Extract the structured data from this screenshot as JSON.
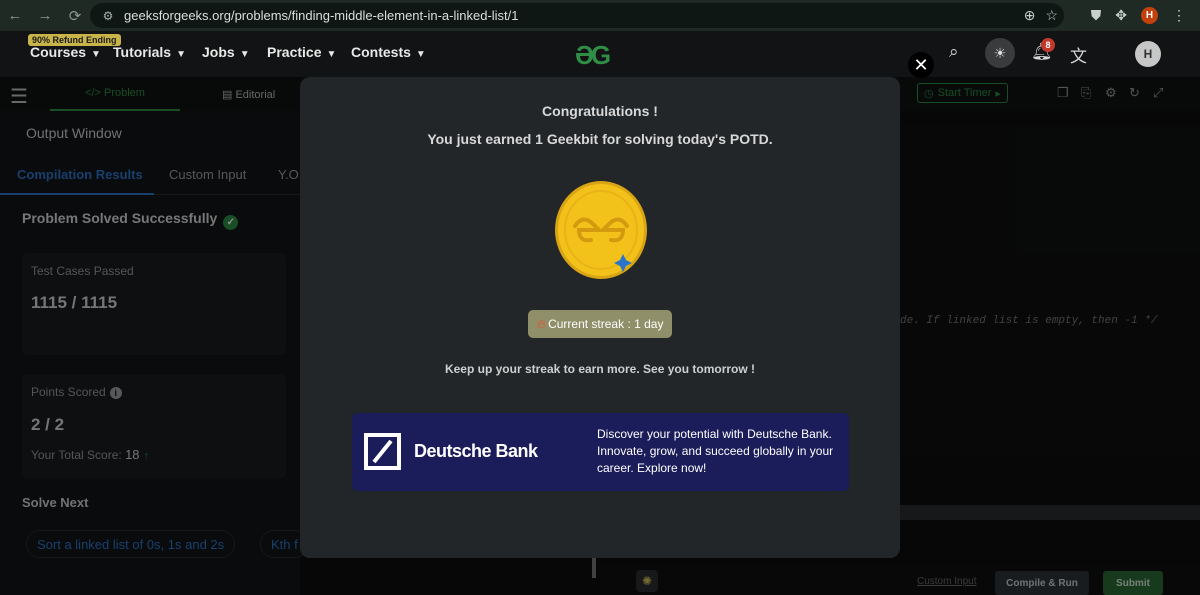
{
  "browser": {
    "url": "geeksforgeeks.org/problems/finding-middle-element-in-a-linked-list/1",
    "back_icon": "←",
    "forward_icon": "→",
    "reload_icon": "⟳",
    "profile_initial": "H"
  },
  "topnav": {
    "refund_badge": "90% Refund Ending",
    "items": [
      {
        "label": "Courses"
      },
      {
        "label": "Tutorials"
      },
      {
        "label": "Jobs"
      },
      {
        "label": "Practice"
      },
      {
        "label": "Contests"
      }
    ],
    "logo_text": "ƏG",
    "notification_count": "8",
    "avatar_initial": "H"
  },
  "subtoolbar": {
    "problem_tab": "</> Problem",
    "editorial_tab": "Editorial",
    "start_timer": "Start Timer"
  },
  "output": {
    "title": "Output Window",
    "tabs": [
      "Compilation Results",
      "Custom Input",
      "Y.O."
    ],
    "status": "Problem Solved Successfully",
    "test_cases_label": "Test Cases Passed",
    "test_cases_value": "1115 / 1115",
    "points_label": "Points Scored",
    "points_value": "2 / 2",
    "total_score_label": "Your Total Score:",
    "total_score_value": "18",
    "solve_next": "Solve Next",
    "next_chips": [
      "Sort a linked list of 0s, 1s and 2s",
      "Kth f"
    ]
  },
  "editor": {
    "comment": "de. If linked list is empty, then -1 */",
    "custom_input": "Custom Input",
    "compile_run": "Compile & Run",
    "submit": "Submit"
  },
  "modal": {
    "title": "Congratulations !",
    "subtitle": "You just earned 1 Geekbit for solving today's POTD.",
    "streak": "Current streak : 1 day",
    "keep_up": "Keep up your streak to earn more. See you tomorrow !",
    "ad": {
      "brand": "Deutsche Bank",
      "copy": "Discover your potential with Deutsche Bank. Innovate, grow, and succeed globally in your career. Explore now!",
      "bg_color": "#1b1c5a"
    }
  },
  "colors": {
    "gfg_green": "#2f8d46",
    "link_blue": "#2c74c9",
    "coin_gold": "#f2c21b"
  }
}
